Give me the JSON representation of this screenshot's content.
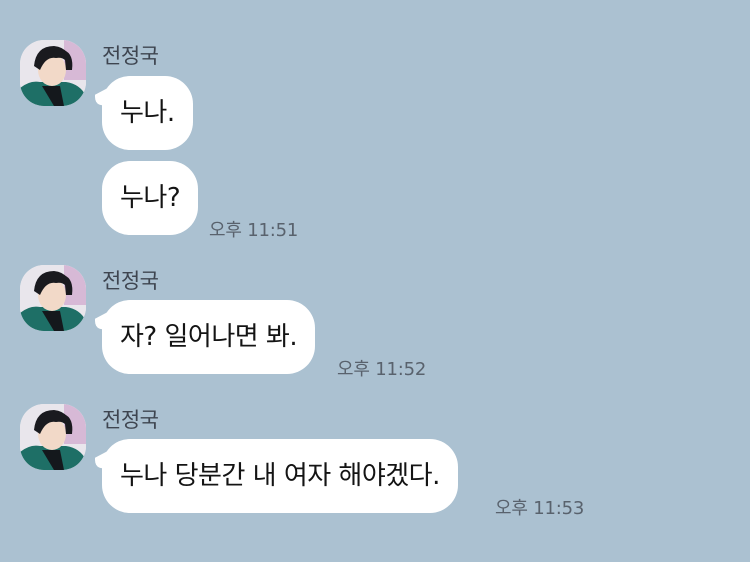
{
  "messages": [
    {
      "sender": "전정국",
      "bubbles": [
        "누나.",
        "누나?"
      ],
      "time": "오후 11:51"
    },
    {
      "sender": "전정국",
      "bubbles": [
        "자? 일어나면 봐."
      ],
      "time": "오후 11:52"
    },
    {
      "sender": "전정국",
      "bubbles": [
        "누나 당분간 내 여자 해야겠다."
      ],
      "time": "오후 11:53"
    }
  ],
  "colors": {
    "background": "#abc1d1",
    "bubble": "#ffffff",
    "sender_text": "#3e4550",
    "time_text": "#59626d"
  },
  "icons": {
    "avatar": "profile-photo"
  }
}
